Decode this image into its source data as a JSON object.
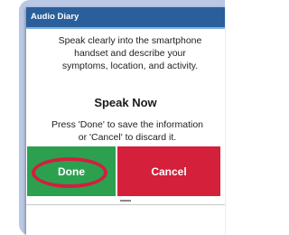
{
  "dialog": {
    "title": "Audio Diary",
    "instructions": "Speak clearly into the smartphone handset and describe your symptoms, location, and activity.",
    "heading": "Speak Now",
    "hint": "Press 'Done' to save the information or 'Cancel' to discard it."
  },
  "buttons": {
    "done_label": "Done",
    "cancel_label": "Cancel"
  },
  "colors": {
    "title_bar": "#2a5f9b",
    "done": "#2da050",
    "cancel": "#d4203a",
    "highlight_ring": "#d0203e"
  }
}
